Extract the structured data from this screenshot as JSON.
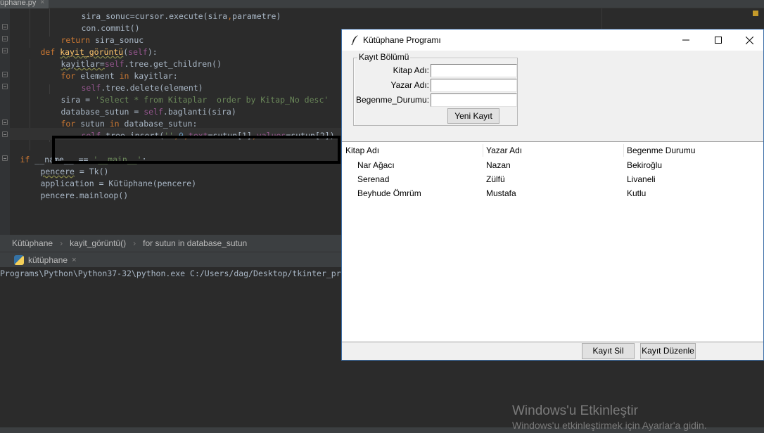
{
  "ide": {
    "file_tab": "üphane.py",
    "tab_close": "×",
    "code": [
      {
        "indent": 7,
        "parts": [
          {
            "t": "sira_sonuc=cursor.execute(sira",
            "c": ""
          },
          {
            "t": ",",
            "c": "kw"
          },
          {
            "t": "parametre)",
            "c": ""
          }
        ]
      },
      {
        "indent": 7,
        "parts": [
          {
            "t": "con.commit()",
            "c": ""
          }
        ]
      },
      {
        "indent": 5,
        "parts": [
          {
            "t": "return ",
            "c": "kw"
          },
          {
            "t": "sira_sonuc",
            "c": ""
          }
        ]
      },
      {
        "indent": 3,
        "parts": [
          {
            "t": "def ",
            "c": "kw"
          },
          {
            "t": "kayit_görüntü",
            "c": "fn und"
          },
          {
            "t": "(",
            "c": ""
          },
          {
            "t": "self",
            "c": "self"
          },
          {
            "t": "):",
            "c": ""
          }
        ]
      },
      {
        "indent": 5,
        "parts": [
          {
            "t": "kayitlar=",
            "c": "und"
          },
          {
            "t": "self",
            "c": "self"
          },
          {
            "t": ".tree.get_children()",
            "c": ""
          }
        ]
      },
      {
        "indent": 5,
        "parts": [
          {
            "t": "for ",
            "c": "kw"
          },
          {
            "t": "element ",
            "c": ""
          },
          {
            "t": "in ",
            "c": "kw"
          },
          {
            "t": "kayitlar:",
            "c": ""
          }
        ]
      },
      {
        "indent": 7,
        "parts": [
          {
            "t": "self",
            "c": "self"
          },
          {
            "t": ".tree.delete(element)",
            "c": ""
          }
        ]
      },
      {
        "indent": 5,
        "parts": [
          {
            "t": "sira = ",
            "c": ""
          },
          {
            "t": "'Select * from Kitaplar  order by Kitap_No desc'",
            "c": "str"
          }
        ]
      },
      {
        "indent": 5,
        "parts": [
          {
            "t": "database_sutun = ",
            "c": ""
          },
          {
            "t": "self",
            "c": "self"
          },
          {
            "t": ".baglanti(sira)",
            "c": ""
          }
        ]
      },
      {
        "indent": 5,
        "parts": [
          {
            "t": "for ",
            "c": "kw"
          },
          {
            "t": "sutun ",
            "c": ""
          },
          {
            "t": "in ",
            "c": "kw"
          },
          {
            "t": "database_sutun:",
            "c": ""
          }
        ]
      },
      {
        "indent": 7,
        "parts": [
          {
            "t": "self",
            "c": "self"
          },
          {
            "t": ".tree.insert(",
            "c": ""
          },
          {
            "t": "''",
            "c": "str"
          },
          {
            "t": ",",
            "c": "kw"
          },
          {
            "t": "0",
            "c": "num"
          },
          {
            "t": ",",
            "c": "kw"
          },
          {
            "t": "text",
            "c": "self"
          },
          {
            "t": "=sutun[1]",
            "c": ""
          },
          {
            "t": ",",
            "c": "kw"
          },
          {
            "t": "values",
            "c": "self"
          },
          {
            "t": "=sutun[2])",
            "c": ""
          }
        ]
      },
      {
        "indent": 0,
        "parts": [
          {
            "t": "",
            "c": ""
          }
        ]
      },
      {
        "indent": 1,
        "parts": [
          {
            "t": "if ",
            "c": "kw"
          },
          {
            "t": "__name__ == ",
            "c": ""
          },
          {
            "t": "'__main__'",
            "c": "str"
          },
          {
            "t": ":",
            "c": ""
          }
        ]
      },
      {
        "indent": 3,
        "parts": [
          {
            "t": "pencere",
            "c": "und"
          },
          {
            "t": " = Tk()",
            "c": ""
          }
        ]
      },
      {
        "indent": 3,
        "parts": [
          {
            "t": "application = Kütüphane(pencere)",
            "c": ""
          }
        ]
      },
      {
        "indent": 3,
        "parts": [
          {
            "t": "pencere.mainloop()",
            "c": ""
          }
        ]
      }
    ],
    "breadcrumbs": [
      "Kütüphane",
      "kayit_görüntü()",
      "for sutun in database_sutun"
    ],
    "breadcrumb_sep": "›",
    "run_tab": "kütüphane",
    "run_close": "×",
    "console_line": "Programs\\Python\\Python37-32\\python.exe C:/Users/dag/Desktop/tkinter_pr"
  },
  "window": {
    "title": "Kütüphane Programı",
    "form": {
      "legend": "Kayıt Bölümü",
      "kitap_label": "Kitap Adı:",
      "yazar_label": "Yazar Adı:",
      "begenme_label": "Begenme_Durumu:",
      "kitap_value": "",
      "yazar_value": "",
      "begenme_value": "",
      "yeni_kayit": "Yeni Kayıt"
    },
    "tree": {
      "columns": [
        "Kitap Adı",
        "Yazar Adı",
        "Begenme Durumu"
      ],
      "rows": [
        [
          "Nar Ağacı",
          "Nazan",
          "Bekiroğlu"
        ],
        [
          "Serenad",
          "Zülfü",
          "Livaneli"
        ],
        [
          "Beyhude Ömrüm",
          "Mustafa",
          "Kutlu"
        ]
      ]
    },
    "buttons": {
      "kayit_sil": "Kayıt Sil",
      "kayit_duzenle": "Kayıt Düzenle"
    }
  },
  "watermark": {
    "title": "Windows'u Etkinleştir",
    "subtitle": "Windows'u etkinleştirmek için Ayarlar'a gidin."
  }
}
